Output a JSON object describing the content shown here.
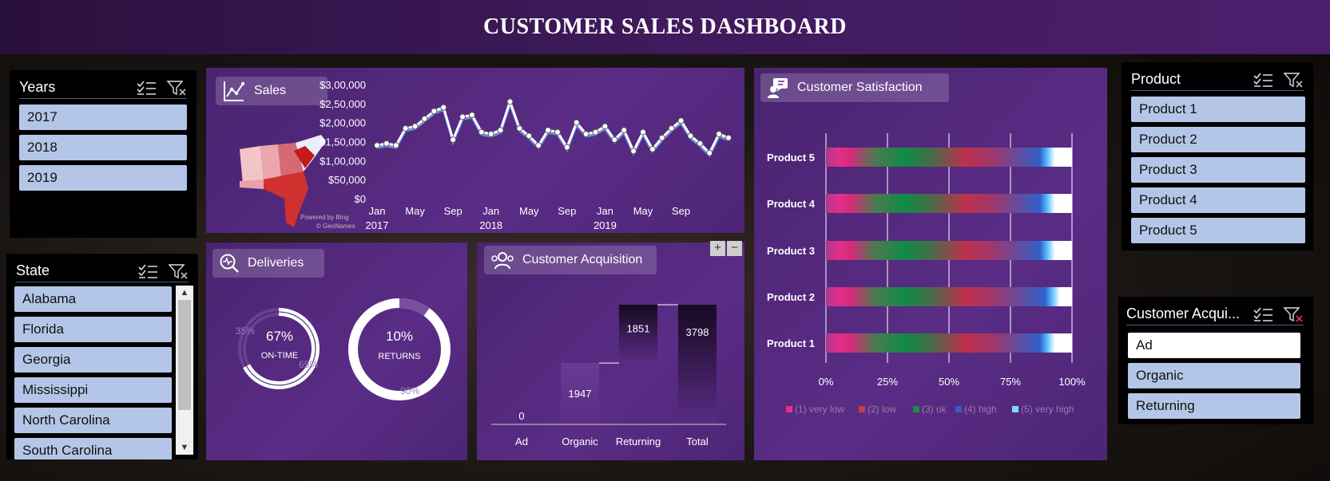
{
  "title": "CUSTOMER SALES DASHBOARD",
  "years_slicer": {
    "title": "Years",
    "items": [
      "2017",
      "2018",
      "2019"
    ]
  },
  "state_slicer": {
    "title": "State",
    "items": [
      "Alabama",
      "Florida",
      "Georgia",
      "Mississippi",
      "North Carolina",
      "South Carolina"
    ]
  },
  "product_slicer": {
    "title": "Product",
    "items": [
      "Product 1",
      "Product 2",
      "Product 3",
      "Product 4",
      "Product 5"
    ]
  },
  "acq_slicer": {
    "title": "Customer Acqui...",
    "items": [
      "Ad",
      "Organic",
      "Returning"
    ]
  },
  "sales": {
    "label": "Sales",
    "map_credit_1": "Powered by Bing",
    "map_credit_2": "© GeoNames"
  },
  "deliveries": {
    "label": "Deliveries",
    "ontime_pct": "67%",
    "ontime_label": "ON-TIME",
    "ontime_small_a": "35%",
    "ontime_small_b": "65%",
    "returns_pct": "10%",
    "returns_label": "RETURNS",
    "returns_small": "90%",
    "ontime_value": 0.67,
    "returns_value": 0.1
  },
  "acquisition": {
    "label": "Customer Acquisition",
    "zoom_in": "+",
    "zoom_out": "−"
  },
  "satisfaction": {
    "label": "Customer Satisfaction"
  },
  "colors": {
    "panel": "#5a2c86",
    "slicer_item": "#b4c6e7",
    "line": "#ffffff"
  },
  "chart_data": [
    {
      "type": "line",
      "title": "Sales",
      "x_tick_labels": [
        "Jan",
        "May",
        "Sep",
        "Jan",
        "May",
        "Sep",
        "Jan",
        "May",
        "Sep"
      ],
      "x_year_labels": [
        "2017",
        "2018",
        "2019"
      ],
      "y_tick_labels": [
        "$0",
        "$50,000",
        "$1,00,000",
        "$1,50,000",
        "$2,00,000",
        "$2,50,000",
        "$3,00,000"
      ],
      "ylim": [
        0,
        300000
      ],
      "values": [
        140000,
        145000,
        140000,
        185000,
        190000,
        210000,
        230000,
        240000,
        155000,
        215000,
        220000,
        175000,
        170000,
        180000,
        255000,
        185000,
        165000,
        140000,
        180000,
        175000,
        135000,
        200000,
        170000,
        175000,
        190000,
        155000,
        180000,
        125000,
        175000,
        130000,
        160000,
        185000,
        205000,
        165000,
        145000,
        120000,
        170000,
        160000
      ]
    },
    {
      "type": "bar",
      "title": "Customer Acquisition",
      "categories": [
        "Ad",
        "Organic",
        "Returning",
        "Total"
      ],
      "values": [
        0,
        1947,
        1851,
        3798
      ],
      "data_labels": [
        "0",
        "1947",
        "1851",
        "3798"
      ]
    },
    {
      "type": "bar",
      "title": "Customer Satisfaction",
      "categories": [
        "Product 5",
        "Product 4",
        "Product 3",
        "Product 2",
        "Product 1"
      ],
      "x_tick_labels": [
        "0%",
        "25%",
        "50%",
        "75%",
        "100%"
      ],
      "legend": [
        "(1) very low",
        "(2) low",
        "(3) ok",
        "(4) high",
        "(5) very high"
      ],
      "legend_colors": [
        "#e0308c",
        "#c0404c",
        "#1a8a4a",
        "#3a5ac0",
        "#7fd8ff"
      ],
      "series_stops": [
        [
          0.1,
          0.2,
          0.55,
          0.9,
          1.0
        ],
        [
          0.1,
          0.2,
          0.55,
          0.9,
          1.0
        ],
        [
          0.1,
          0.2,
          0.55,
          0.9,
          1.0
        ],
        [
          0.1,
          0.2,
          0.55,
          0.92,
          1.0
        ],
        [
          0.1,
          0.2,
          0.55,
          0.9,
          1.0
        ]
      ]
    }
  ]
}
